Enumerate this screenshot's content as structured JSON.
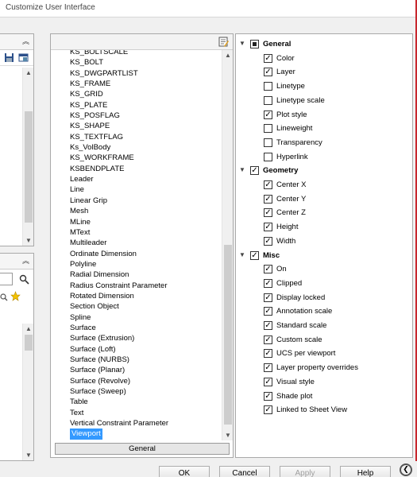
{
  "window": {
    "title": "Customize User Interface"
  },
  "object_list": {
    "items": [
      "KS_BOLTSCALE",
      "KS_BOLT",
      "KS_DWGPARTLIST",
      "KS_FRAME",
      "KS_GRID",
      "KS_PLATE",
      "KS_POSFLAG",
      "KS_SHAPE",
      "KS_TEXTFLAG",
      "Ks_VolBody",
      "KS_WORKFRAME",
      "KSBENDPLATE",
      "Leader",
      "Line",
      "Linear Grip",
      "Mesh",
      "MLine",
      "MText",
      "Multileader",
      "Ordinate Dimension",
      "Polyline",
      "Radial Dimension",
      "Radius Constraint Parameter",
      "Rotated Dimension",
      "Section Object",
      "Spline",
      "Surface",
      "Surface (Extrusion)",
      "Surface (Loft)",
      "Surface (NURBS)",
      "Surface (Planar)",
      "Surface (Revolve)",
      "Surface (Sweep)",
      "Table",
      "Text",
      "Vertical Constraint Parameter",
      "Viewport"
    ],
    "selected": "Viewport",
    "footer_button": "General"
  },
  "properties": {
    "groups": [
      {
        "name": "General",
        "state": "indeterminate",
        "items": [
          {
            "label": "Color",
            "checked": true
          },
          {
            "label": "Layer",
            "checked": true
          },
          {
            "label": "Linetype",
            "checked": false
          },
          {
            "label": "Linetype scale",
            "checked": false
          },
          {
            "label": "Plot style",
            "checked": true
          },
          {
            "label": "Lineweight",
            "checked": false
          },
          {
            "label": "Transparency",
            "checked": false
          },
          {
            "label": "Hyperlink",
            "checked": false
          }
        ]
      },
      {
        "name": "Geometry",
        "state": "checked",
        "items": [
          {
            "label": "Center X",
            "checked": true
          },
          {
            "label": "Center Y",
            "checked": true
          },
          {
            "label": "Center Z",
            "checked": true
          },
          {
            "label": "Height",
            "checked": true
          },
          {
            "label": "Width",
            "checked": true
          }
        ]
      },
      {
        "name": "Misc",
        "state": "checked",
        "items": [
          {
            "label": "On",
            "checked": true
          },
          {
            "label": "Clipped",
            "checked": true
          },
          {
            "label": "Display locked",
            "checked": true
          },
          {
            "label": "Annotation scale",
            "checked": true
          },
          {
            "label": "Standard scale",
            "checked": true
          },
          {
            "label": "Custom scale",
            "checked": true
          },
          {
            "label": "UCS per viewport",
            "checked": true
          },
          {
            "label": "Layer property overrides",
            "checked": true
          },
          {
            "label": "Visual style",
            "checked": true
          },
          {
            "label": "Shade plot",
            "checked": true
          },
          {
            "label": "Linked to Sheet View",
            "checked": true
          }
        ]
      }
    ]
  },
  "buttons": {
    "ok": "OK",
    "cancel": "Cancel",
    "apply": "Apply",
    "help": "Help"
  },
  "colors": {
    "selection": "#3399ff",
    "accent_edge": "#c8282e"
  }
}
